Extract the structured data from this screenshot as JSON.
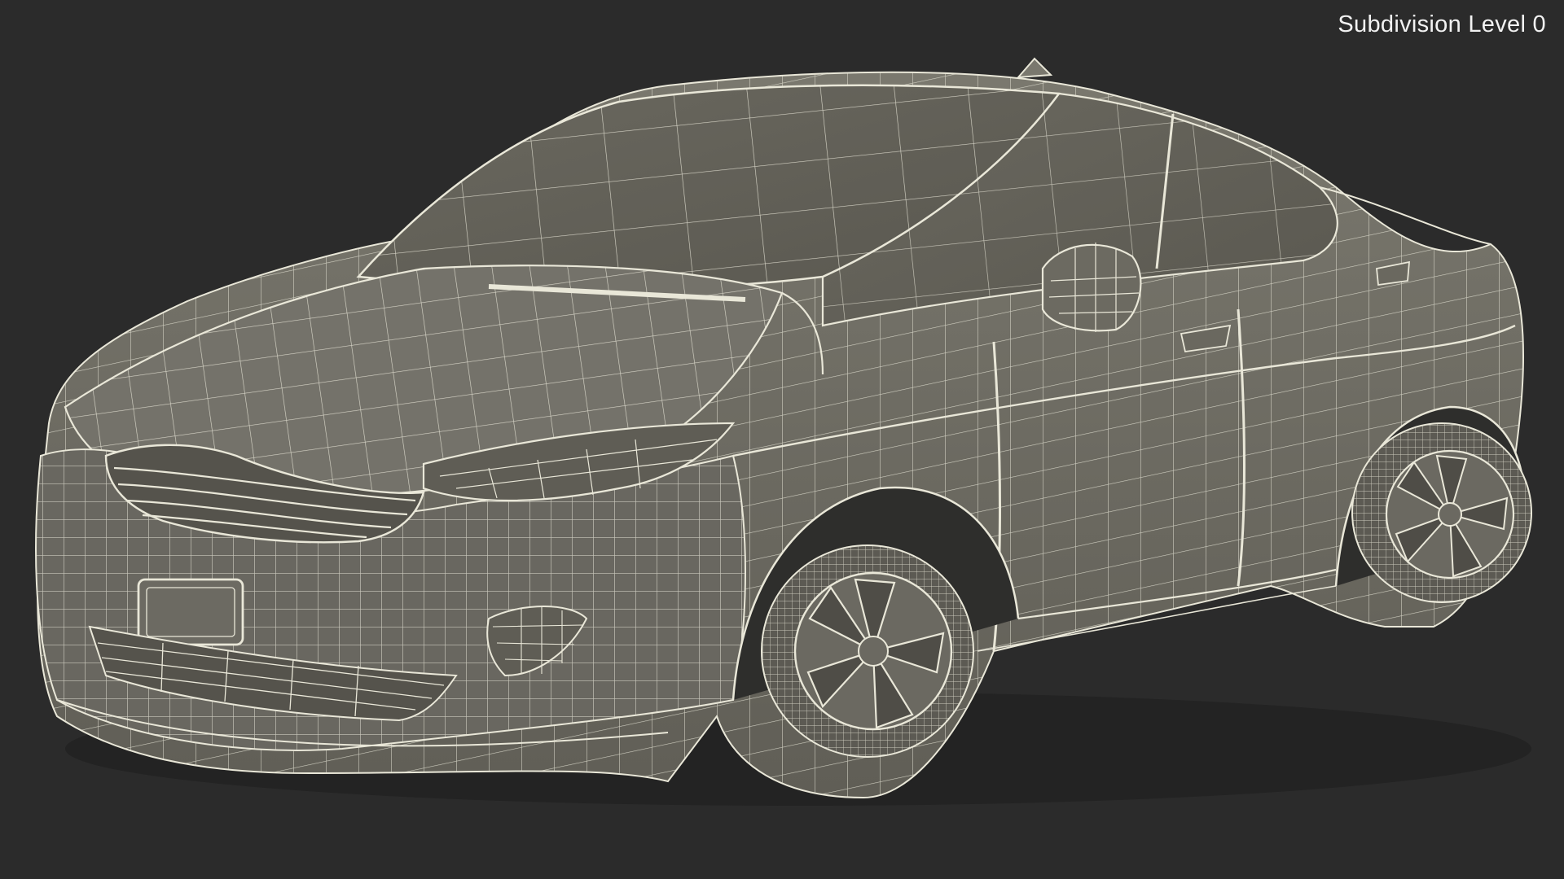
{
  "viewport": {
    "label": "Subdivision Level 0",
    "background": "#2b2b2b"
  },
  "model": {
    "subject": "car-wireframe",
    "surface_color": "#6f6d64",
    "shadow_color": "#4a4943",
    "wire_color": "#e9e7d8"
  }
}
